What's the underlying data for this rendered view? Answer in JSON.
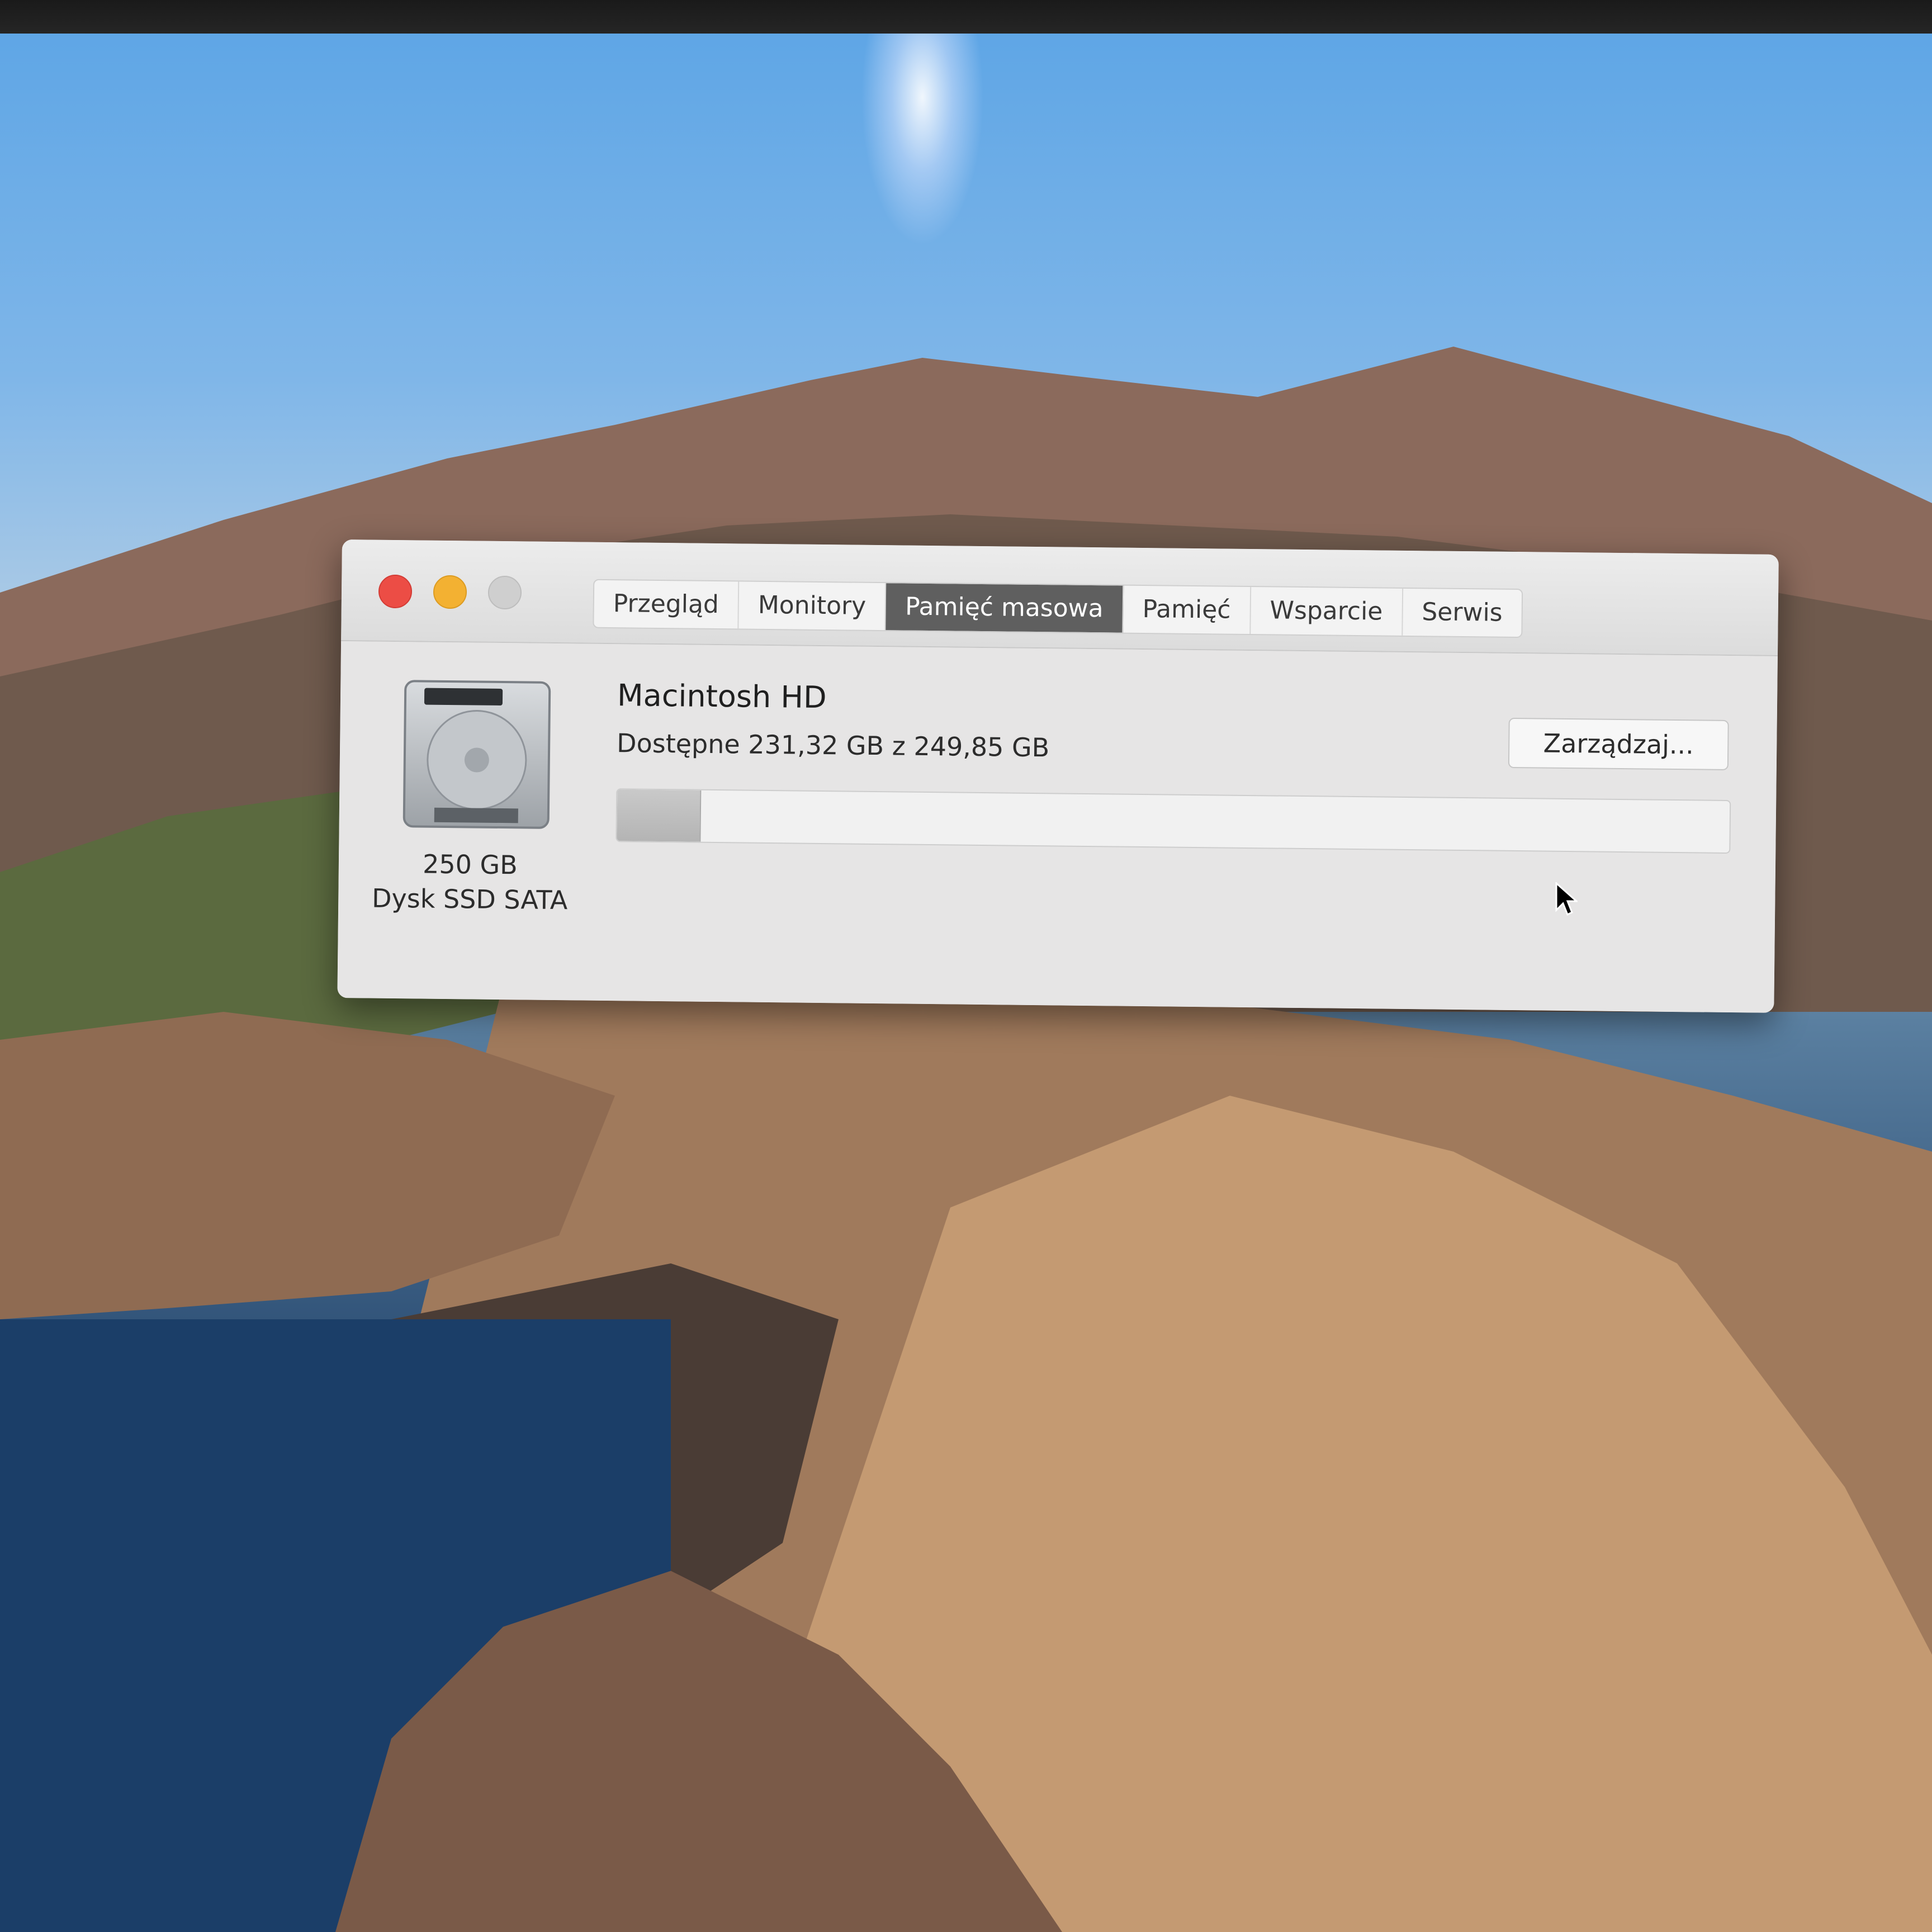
{
  "window": {
    "tabs": [
      {
        "label": "Przegląd"
      },
      {
        "label": "Monitory"
      },
      {
        "label": "Pamięć masowa"
      },
      {
        "label": "Pamięć"
      },
      {
        "label": "Wsparcie"
      },
      {
        "label": "Serwis"
      }
    ],
    "active_tab": "Pamięć masowa"
  },
  "storage": {
    "disk_capacity": "250 GB",
    "disk_type": "Dysk SSD SATA",
    "volume_name": "Macintosh HD",
    "availability_text": "Dostępne 231,32 GB z 249,85 GB",
    "manage_button_label": "Zarządzaj...",
    "available_gb": 231.32,
    "total_gb": 249.85
  },
  "colors": {
    "close": "#ec4d45",
    "minimize": "#f3b132",
    "zoom_inactive": "#cfcfcf",
    "active_tab_bg": "#5f5f5f"
  },
  "icons": [
    "hard-drive-icon",
    "mouse-pointer-icon"
  ]
}
